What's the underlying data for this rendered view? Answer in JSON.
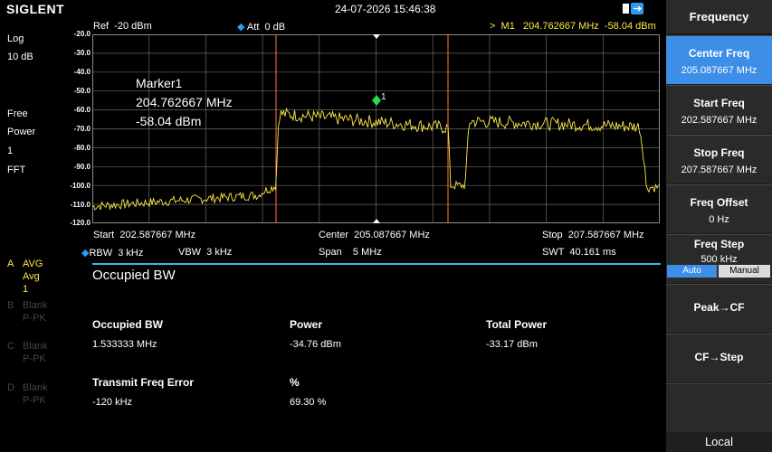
{
  "top": {
    "brand": "SIGLENT",
    "datetime": "24-07-2026 15:46:38"
  },
  "status": {
    "ref": "Ref  -20 dBm",
    "att": "Att  0 dB",
    "marker": ">  M1   204.762667 MHz  -58.04 dBm"
  },
  "left": {
    "scale_type": "Log",
    "scale_div": "10 dB",
    "mode1": "Free",
    "mode2": "Power",
    "mode3": "1",
    "mode4": "FFT",
    "trace_letter": "A",
    "trace_mode": "AVG",
    "trace_sub": "Avg",
    "trace_count": "1",
    "traces": [
      {
        "letter": "B",
        "l1": "Blank",
        "l2": "P-PK"
      },
      {
        "letter": "C",
        "l1": "Blank",
        "l2": "P-PK"
      },
      {
        "letter": "D",
        "l1": "Blank",
        "l2": "P-PK"
      }
    ]
  },
  "yaxis": [
    "-20.0",
    "-30.0",
    "-40.0",
    "-50.0",
    "-60.0",
    "-70.0",
    "-80.0",
    "-90.0",
    "-100.0",
    "-110.0",
    "-120.0"
  ],
  "marker_box": {
    "name": "Marker1",
    "freq": "204.762667 MHz",
    "level": "-58.04 dBm",
    "label": "1"
  },
  "params": {
    "start": "Start  202.587667 MHz",
    "center": "Center  205.087667 MHz",
    "stop": "Stop  207.587667 MHz",
    "rbw": "RBW  3 kHz",
    "vbw": "VBW  3 kHz",
    "span": "Span    5 MHz",
    "swt": "SWT  40.161 ms"
  },
  "measurement": {
    "title": "Occupied BW",
    "occ_bw_label": "Occupied BW",
    "occ_bw_value": "1.533333 MHz",
    "power_label": "Power",
    "power_value": "-34.76 dBm",
    "total_power_label": "Total Power",
    "total_power_value": "-33.17 dBm",
    "freq_err_label": "Transmit Freq Error",
    "freq_err_value": "-120 kHz",
    "pct_label": "%",
    "pct_value": "69.30 %"
  },
  "softkeys": {
    "header": "Frequency",
    "items": [
      {
        "title": "Center Freq",
        "value": "205.087667 MHz",
        "active": true
      },
      {
        "title": "Start Freq",
        "value": "202.587667 MHz"
      },
      {
        "title": "Stop Freq",
        "value": "207.587667 MHz"
      },
      {
        "title": "Freq Offset",
        "value": "0 Hz"
      },
      {
        "title": "Freq Step",
        "value": "500 kHz"
      }
    ],
    "toggle_auto": "Auto",
    "toggle_manual": "Manual",
    "peak_cf": "Peak→CF",
    "cf_step": "CF→Step",
    "local": "Local"
  },
  "colors": {
    "trace": "#ffe94a",
    "accent": "#3c8ee6",
    "divider": "#38b6f0",
    "bw_lines": "#ff7a3c",
    "marker": "#22e04a"
  }
}
